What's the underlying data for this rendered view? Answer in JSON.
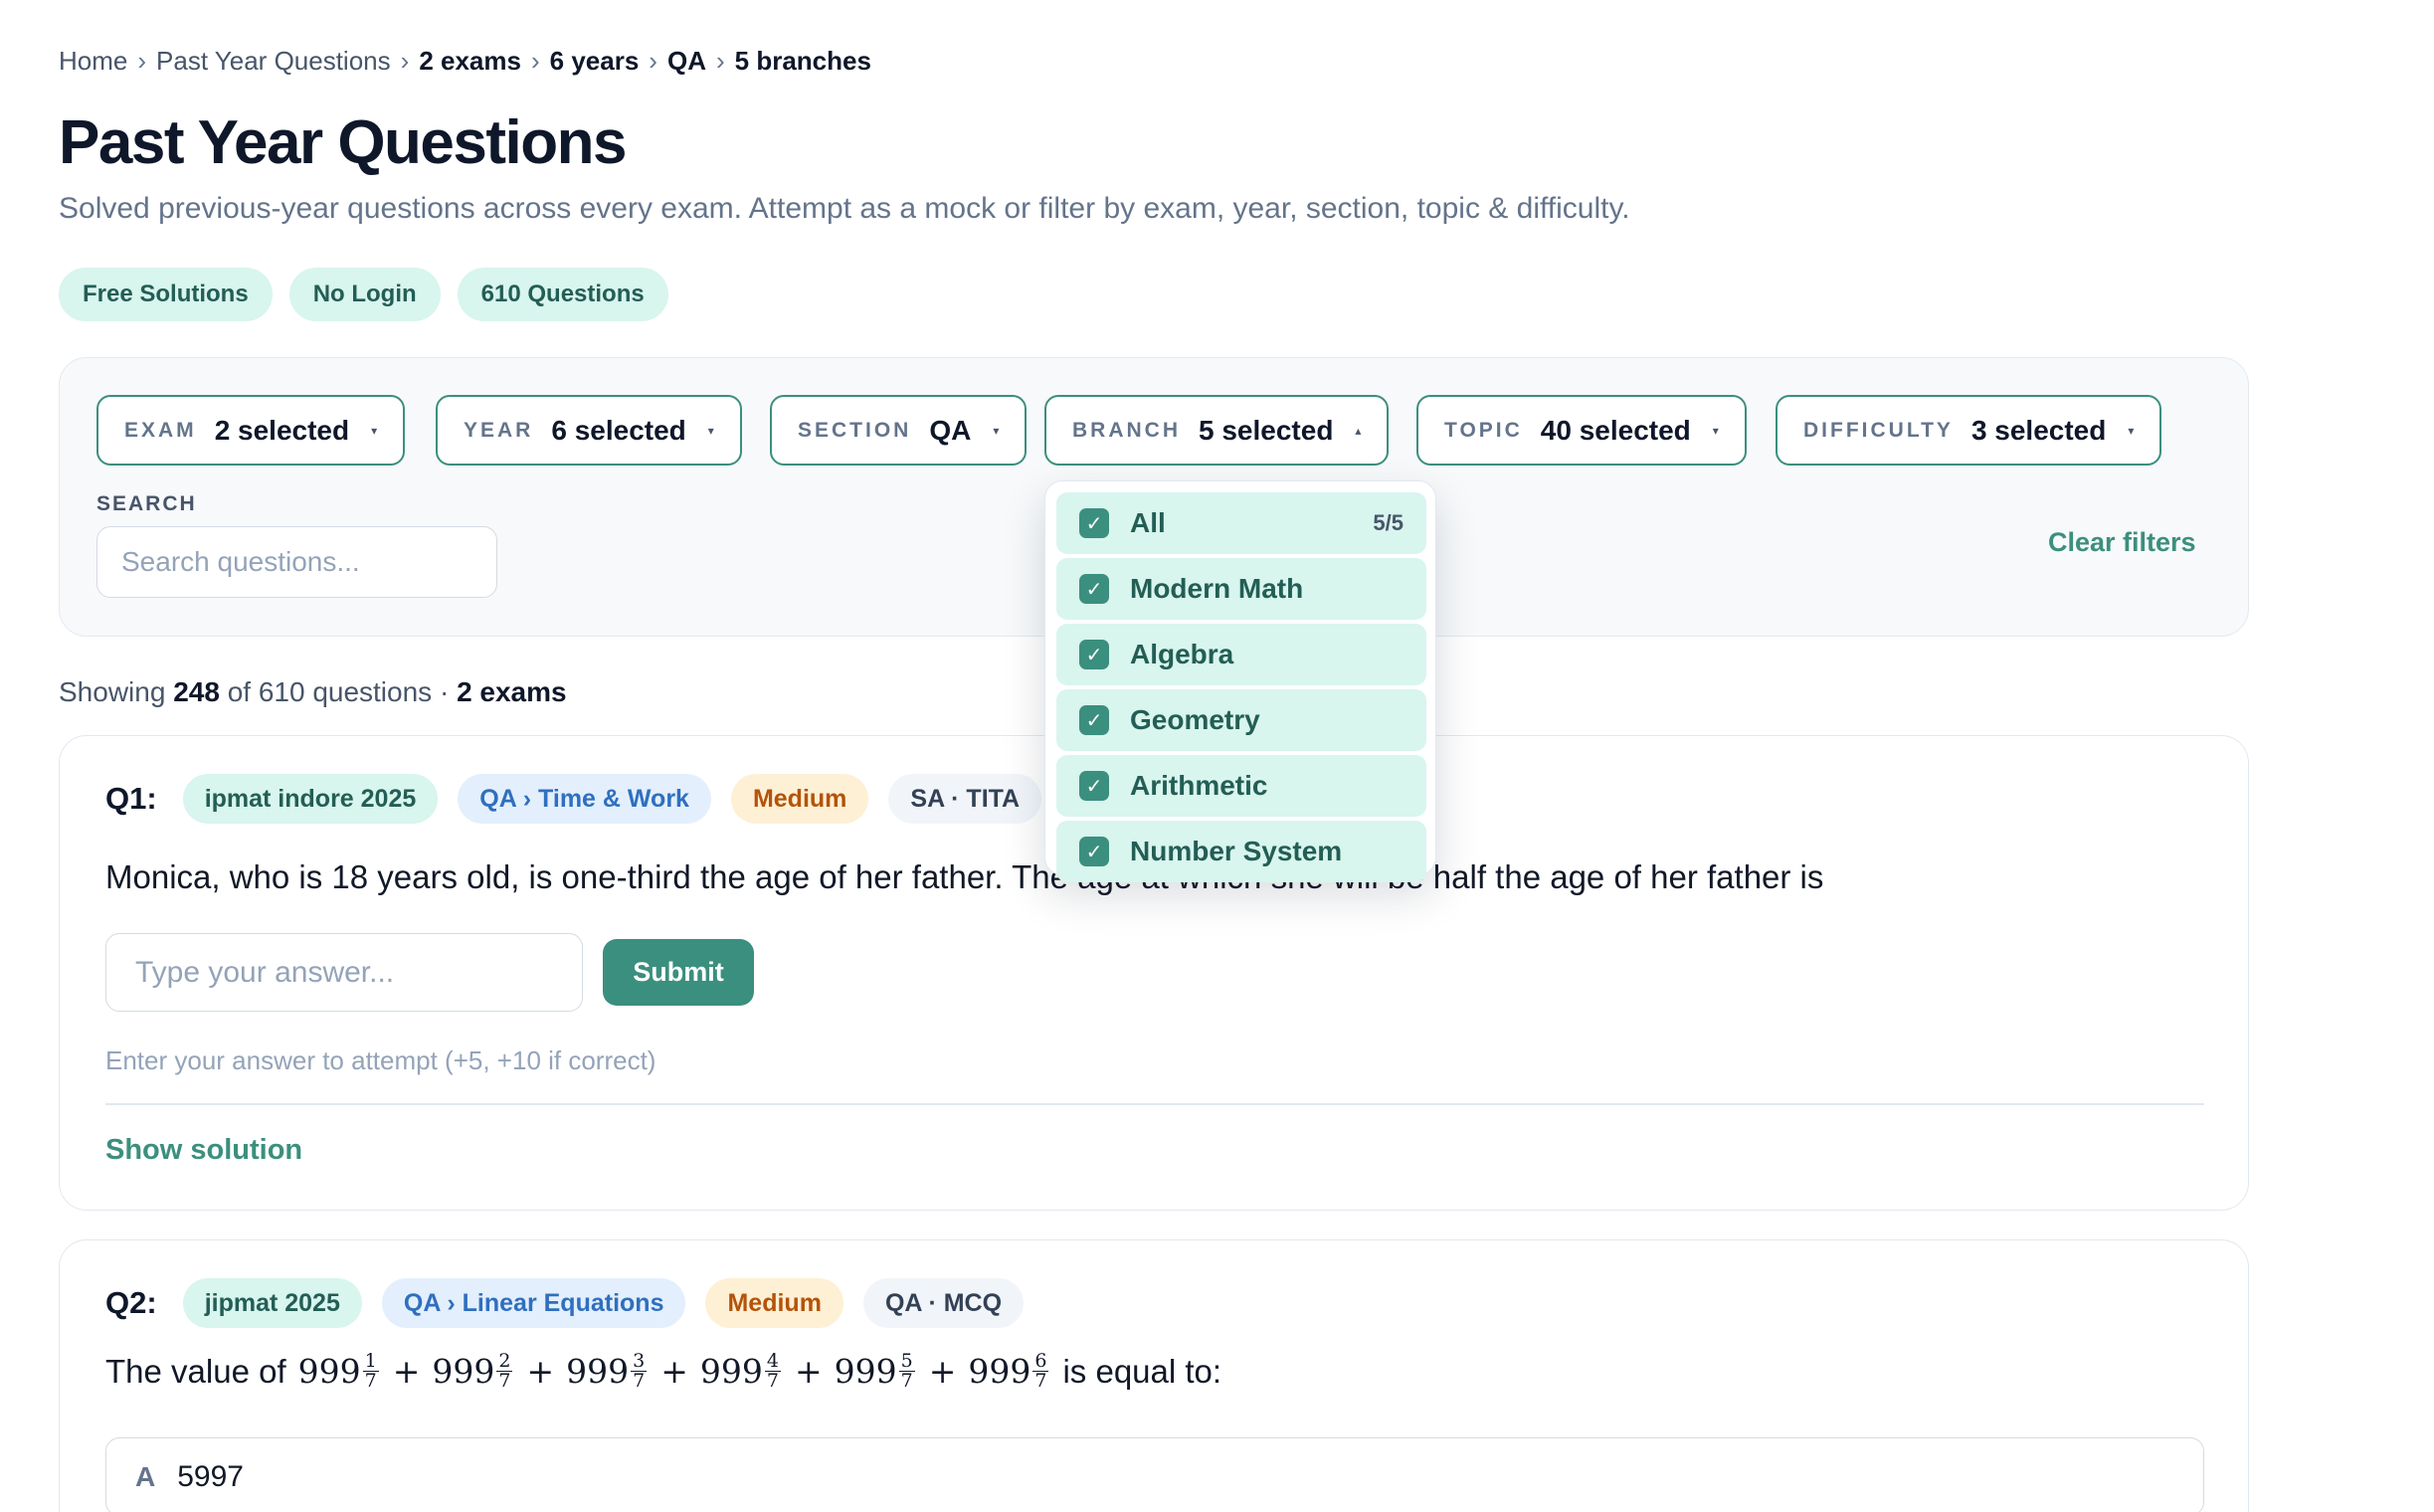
{
  "breadcrumb": {
    "home": "Home",
    "section": "Past Year Questions",
    "exams": "2 exams",
    "years": "6 years",
    "qa": "QA",
    "branches": "5 branches",
    "separator": "›"
  },
  "header": {
    "title": "Past Year Questions",
    "subtitle": "Solved previous-year questions across every exam. Attempt as a mock or filter by exam, year, section, topic & difficulty."
  },
  "badges": [
    "Free Solutions",
    "No Login",
    "610 Questions"
  ],
  "filters": [
    {
      "label": "EXAM",
      "value": "2 selected",
      "caret": "▾"
    },
    {
      "label": "YEAR",
      "value": "6 selected",
      "caret": "▾"
    },
    {
      "label": "SECTION",
      "value": "QA",
      "caret": "▾"
    },
    {
      "label": "BRANCH",
      "value": "5 selected",
      "caret": "▴"
    },
    {
      "label": "TOPIC",
      "value": "40 selected",
      "caret": "▾"
    },
    {
      "label": "DIFFICULTY",
      "value": "3 selected",
      "caret": "▾"
    }
  ],
  "search": {
    "label": "SEARCH",
    "placeholder": "Search questions..."
  },
  "clear_filters": "Clear filters",
  "branch_dropdown": {
    "items": [
      {
        "label": "All",
        "count": "5/5",
        "checked": true
      },
      {
        "label": "Modern Math",
        "checked": true
      },
      {
        "label": "Algebra",
        "checked": true
      },
      {
        "label": "Geometry",
        "checked": true
      },
      {
        "label": "Arithmetic",
        "checked": true
      },
      {
        "label": "Number System",
        "checked": true
      }
    ],
    "check_glyph": "✓"
  },
  "results": {
    "prefix": "Showing",
    "count": "248",
    "of": "of 610 questions ·",
    "exams": "2 exams"
  },
  "questions": [
    {
      "number": "Q1:",
      "exam": "ipmat indore 2025",
      "topic": "QA › Time & Work",
      "difficulty": "Medium",
      "type": "SA · TITA",
      "text": "Monica, who is 18 years old, is one-third the age of her father. The age at which she will be half the age of her father is",
      "answer_placeholder": "Type your answer...",
      "submit_label": "Submit",
      "hint": "Enter your answer to attempt (+5, +10 if correct)",
      "show_solution": "Show solution"
    },
    {
      "number": "Q2:",
      "exam": "jipmat 2025",
      "topic": "QA › Linear Equations",
      "difficulty": "Medium",
      "type": "QA · MCQ",
      "text_prefix": "The value of",
      "math_whole": "999",
      "math_plus": "+",
      "math_denominator": "7",
      "math_numerators": [
        "1",
        "2",
        "3",
        "4",
        "5",
        "6"
      ],
      "text_suffix": "is equal to:",
      "options": [
        {
          "label": "A",
          "text": "5997"
        }
      ]
    }
  ],
  "colors": {
    "accent": "#3b8f7e",
    "accent_light": "#d8f5ee",
    "topic_blue": "#2f6fbf",
    "difficulty_orange": "#b45309"
  }
}
